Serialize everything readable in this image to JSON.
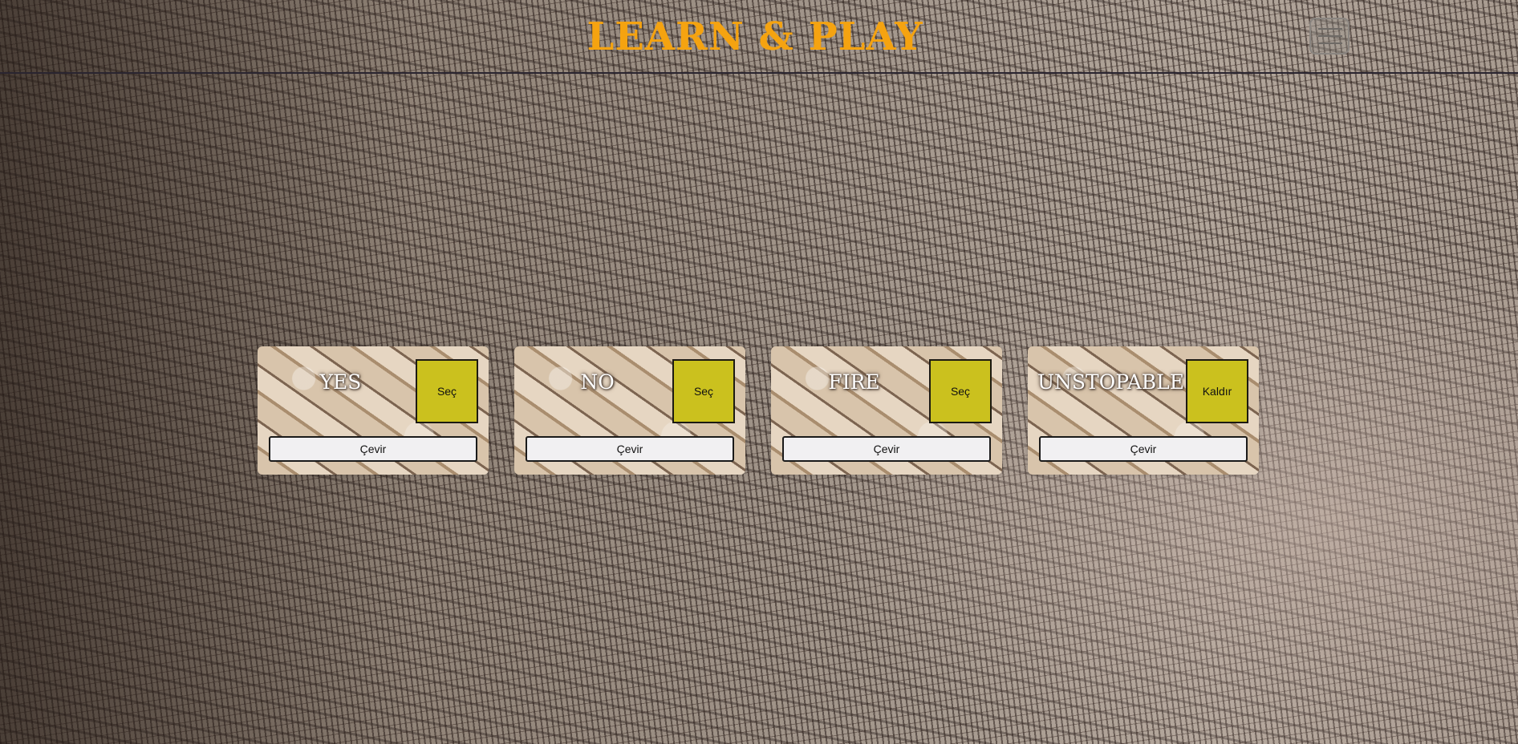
{
  "header": {
    "title": "LEARN & PLAY",
    "menu_icon": "hamburger-menu-icon"
  },
  "cards": [
    {
      "word": "YES",
      "select_label": "Seç",
      "flip_label": "Çevir"
    },
    {
      "word": "NO",
      "select_label": "Seç",
      "flip_label": "Çevir"
    },
    {
      "word": "FIRE",
      "select_label": "Seç",
      "flip_label": "Çevir"
    },
    {
      "word": "UNSTOPABLE",
      "select_label": "Kaldır",
      "flip_label": "Çevir"
    }
  ],
  "colors": {
    "title": "#f5a310",
    "select_button": "#cbc11e",
    "flip_button": "#f1f0f2"
  }
}
